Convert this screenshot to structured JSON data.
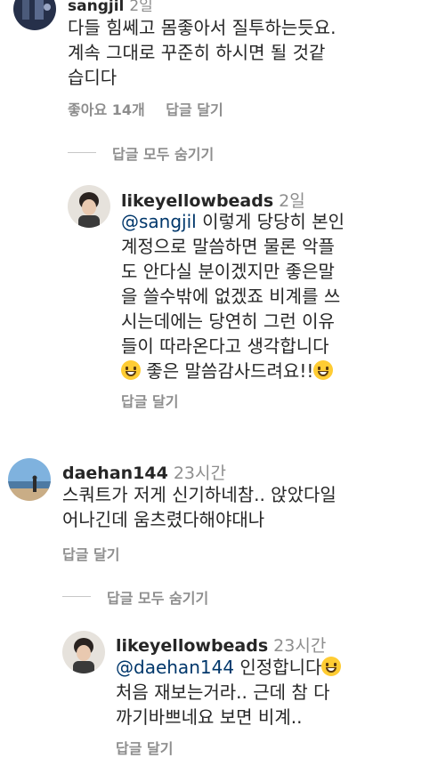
{
  "comment1": {
    "username": "sangjil",
    "time": "2일",
    "lines": [
      "다들 힘쎄고 몸좋아서 질투하는듯요.",
      "계속 그대로 꾸준히 하시면 될 것같",
      "습디다"
    ],
    "likes": "좋아요 14개",
    "reply": "답글 달기"
  },
  "hide_replies_1": "답글 모두 숨기기",
  "reply1": {
    "username": "likeyellowbeads",
    "time": "2일",
    "mention": "@sangjil",
    "line1_rest": " 이렇게 당당히 본인",
    "lines": [
      "계정으로 말씀하면 물론 악플",
      "도 안다실 분이겠지만 좋은말",
      "을 쓸수밖에 없겠죠 비계를 쓰",
      "시는데에는 당연히 그런 이유",
      "들이 따라온다고 생각합니다"
    ],
    "last_line": " 좋은 말씀감사드려요!!",
    "reply": "답글 달기"
  },
  "comment2": {
    "username": "daehan144",
    "time": "23시간",
    "lines": [
      "스쿼트가 저게 신기하네참.. 앉았다일",
      "어나긴데 움츠렸다해야대나"
    ],
    "reply": "답글 달기"
  },
  "hide_replies_2": "답글 모두 숨기기",
  "reply2": {
    "username": "likeyellowbeads",
    "time": "23시간",
    "mention": "@daehan144",
    "line1_rest": " 인정합니다",
    "lines": [
      "처음 재보는거라.. 근데 참 다",
      "까기바쁘네요 보면 비계.."
    ],
    "reply": "답글 달기"
  },
  "icons": {
    "laugh": "tears-of-joy-emoji",
    "grin": "grinning-emoji"
  }
}
